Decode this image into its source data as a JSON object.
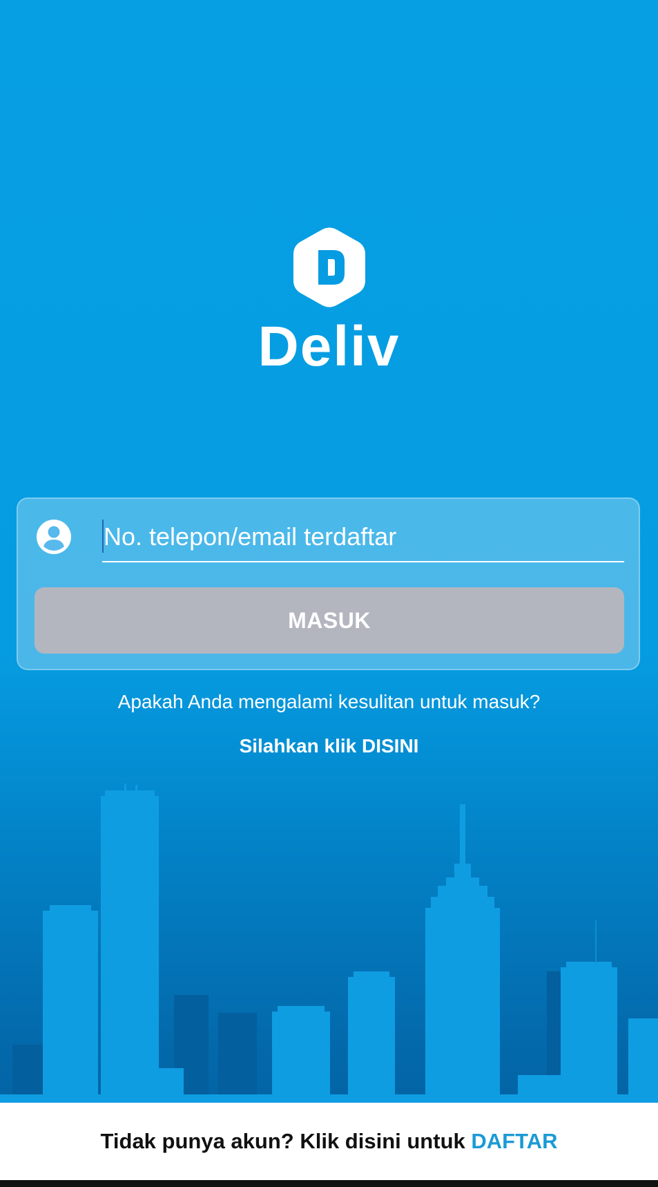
{
  "app": {
    "brand_name": "Deliv",
    "logo_icon": "hexagon-d-icon"
  },
  "login": {
    "user_icon": "user-circle-icon",
    "input_placeholder": "No. telepon/email terdaftar",
    "input_value": "",
    "submit_label": "MASUK"
  },
  "help": {
    "question": "Apakah Anda mengalami kesulitan untuk masuk?",
    "link_label": "Silahkan klik DISINI"
  },
  "footer": {
    "prompt": "Tidak punya akun? Klik disini untuk ",
    "register_label": "DAFTAR"
  },
  "colors": {
    "background": "#079fe4",
    "button_disabled": "#b3b6bf",
    "link_accent": "#1b9ad6",
    "footer_background": "#ffffff"
  }
}
